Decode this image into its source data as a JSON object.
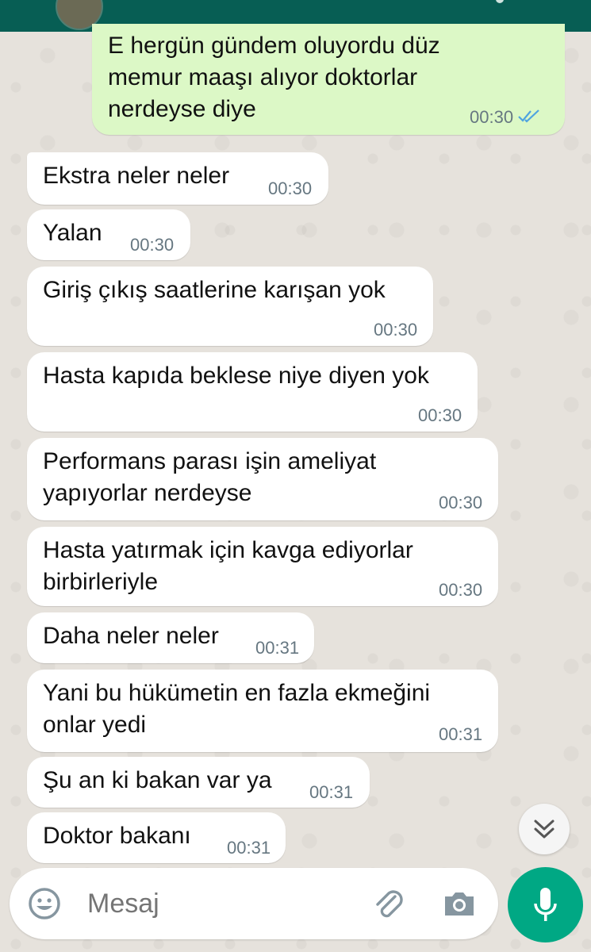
{
  "colors": {
    "header": "#075e54",
    "outgoing_bubble": "#dcf8c6",
    "incoming_bubble": "#ffffff",
    "read_ticks": "#4fa3e0",
    "mic_button": "#00a884"
  },
  "messages": [
    {
      "direction": "out",
      "text": "E hergün gündem oluyordu düz\nmemur maaşı alıyor doktorlar\nnerdeyse diye",
      "time": "00:30",
      "status": "read"
    },
    {
      "direction": "in",
      "text": "Ekstra neler neler",
      "time": "00:30"
    },
    {
      "direction": "in",
      "text": "Yalan",
      "time": "00:30"
    },
    {
      "direction": "in",
      "text": "Giriş çıkış saatlerine karışan yok",
      "time": "00:30"
    },
    {
      "direction": "in",
      "text": "Hasta kapıda beklese niye diyen yok",
      "time": "00:30"
    },
    {
      "direction": "in",
      "text": "Performans parası işin ameliyat\nyapıyorlar nerdeyse",
      "time": "00:30"
    },
    {
      "direction": "in",
      "text": "Hasta yatırmak için kavga ediyorlar\nbirbirleriyle",
      "time": "00:30"
    },
    {
      "direction": "in",
      "text": "Daha neler neler",
      "time": "00:31"
    },
    {
      "direction": "in",
      "text": "Yani bu hükümetin en fazla ekmeğini\nonlar yedi",
      "time": "00:31"
    },
    {
      "direction": "in",
      "text": "Şu an ki bakan var ya",
      "time": "00:31"
    },
    {
      "direction": "in",
      "text": "Doktor bakanı",
      "time": "00:31"
    }
  ],
  "composer": {
    "placeholder": "Mesaj",
    "emoji_icon": "emoji-icon",
    "attach_icon": "paperclip-icon",
    "camera_icon": "camera-icon",
    "mic_icon": "microphone-icon"
  },
  "scroll_down_icon": "double-chevron-down-icon"
}
